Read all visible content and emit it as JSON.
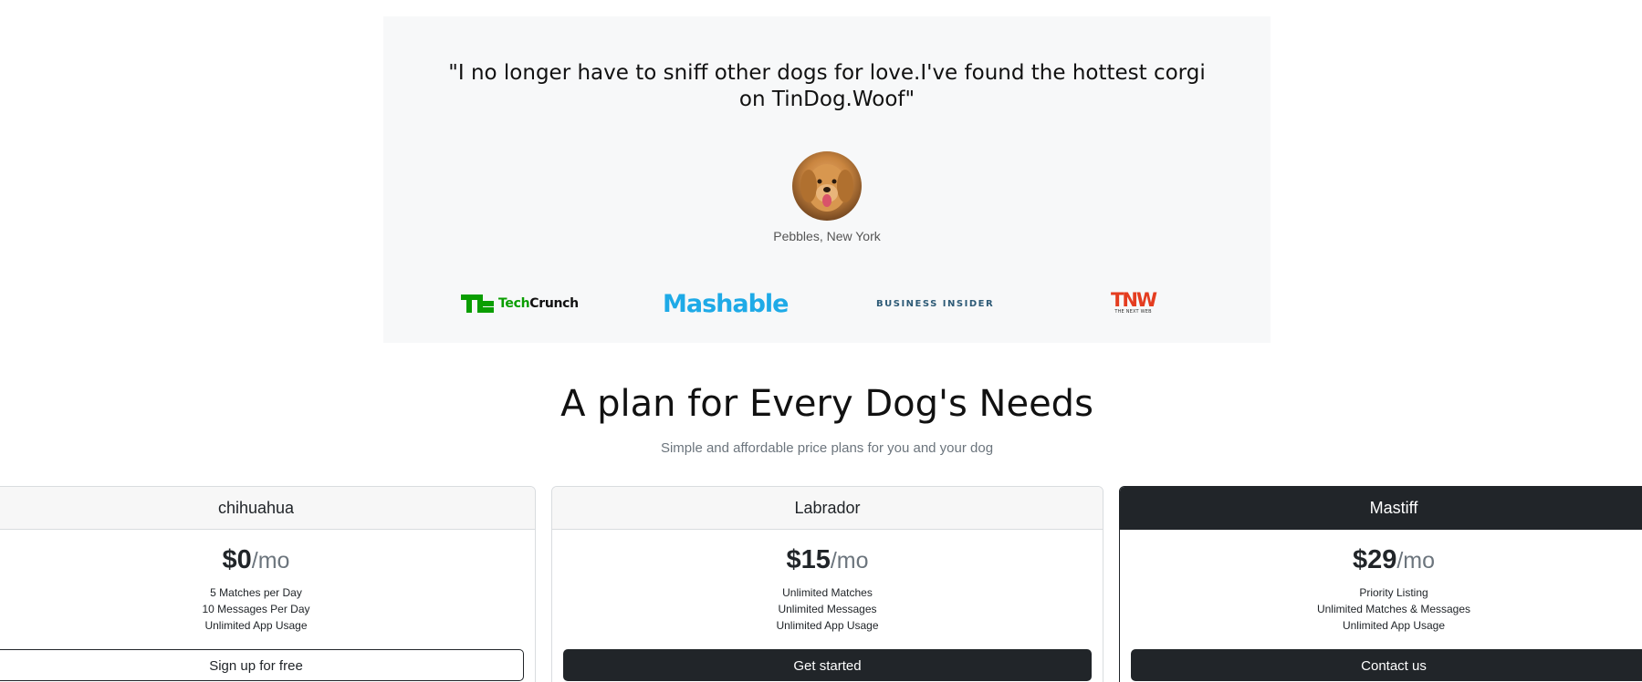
{
  "testimonial": {
    "quote": "\"I no longer have to sniff other dogs for love.I've found the hottest corgi on TinDog.Woof\"",
    "author": "Pebbles, New York",
    "avatar_icon": "dog-avatar",
    "logos": {
      "techcrunch": {
        "tech": "Tech",
        "crunch": "Crunch"
      },
      "mashable": "Mashable",
      "business_insider": "BUSINESS INSIDER",
      "tnw": {
        "big": "TNW",
        "small": "THE NEXT WEB"
      }
    }
  },
  "pricing": {
    "title": "A plan for Every Dog's Needs",
    "subtitle": "Simple and affordable price plans for you and your dog",
    "plans": [
      {
        "name": "chihuahua",
        "amount": "$0",
        "per": "/mo",
        "features": [
          "5 Matches per Day",
          "10 Messages Per Day",
          "Unlimited App Usage"
        ],
        "button": "Sign up for free"
      },
      {
        "name": "Labrador",
        "amount": "$15",
        "per": "/mo",
        "features": [
          "Unlimited Matches",
          "Unlimited Messages",
          "Unlimited App Usage"
        ],
        "button": "Get started"
      },
      {
        "name": "Mastiff",
        "amount": "$29",
        "per": "/mo",
        "features": [
          "Priority Listing",
          "Unlimited Matches & Messages",
          "Unlimited App Usage"
        ],
        "button": "Contact us"
      }
    ]
  },
  "colors": {
    "section_bg": "#f7f8f9",
    "dark": "#212529",
    "muted": "#6c757d",
    "techcrunch_green": "#0a9e01",
    "mashable_blue": "#1eaae7",
    "tnw_red": "#e43d20"
  }
}
